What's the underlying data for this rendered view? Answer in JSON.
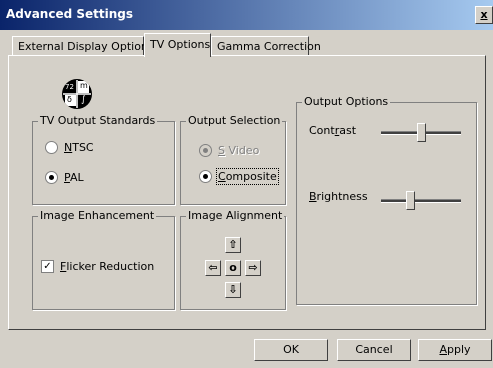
{
  "window": {
    "title": "Advanced Settings",
    "close_glyph": "x"
  },
  "tabs": [
    {
      "label": "External Display Options",
      "active": false
    },
    {
      "label": "TV Options",
      "active": true
    },
    {
      "label": "Gamma Correction",
      "active": false
    }
  ],
  "logo": {
    "cells": [
      "72",
      "m",
      "δ",
      "∫"
    ]
  },
  "tv_output_standards": {
    "legend": "TV Output Standards",
    "options": [
      {
        "label": "NTSC",
        "mnemonic": "N",
        "rest": "TSC",
        "selected": false
      },
      {
        "label": "PAL",
        "mnemonic": "P",
        "rest": "AL",
        "selected": true
      }
    ]
  },
  "output_selection": {
    "legend": "Output Selection",
    "options": [
      {
        "label": "S Video",
        "mnemonic": "S",
        "rest": " Video",
        "selected": true,
        "disabled": true
      },
      {
        "label": "Composite",
        "mnemonic": "C",
        "rest": "omposite",
        "selected": true,
        "disabled": false
      }
    ]
  },
  "output_options": {
    "legend": "Output Options",
    "contrast": {
      "label": "Contrast",
      "pre": "Cont",
      "mnemonic": "r",
      "post": "ast",
      "level": 0.5
    },
    "brightness": {
      "label": "Brightness",
      "mnemonic": "B",
      "rest": "rightness",
      "level": 0.35
    }
  },
  "image_enhancement": {
    "legend": "Image Enhancement",
    "flicker": {
      "label": "Flicker Reduction",
      "mnemonic": "F",
      "rest": "licker Reduction",
      "checked": true,
      "check_glyph": "✓"
    }
  },
  "image_alignment": {
    "legend": "Image Alignment",
    "up": "⇧",
    "down": "⇩",
    "left": "⇦",
    "right": "⇨",
    "center": "o"
  },
  "buttons": {
    "ok": "OK",
    "cancel": "Cancel",
    "apply": "Apply",
    "apply_mnemonic": "A",
    "apply_rest": "pply"
  }
}
